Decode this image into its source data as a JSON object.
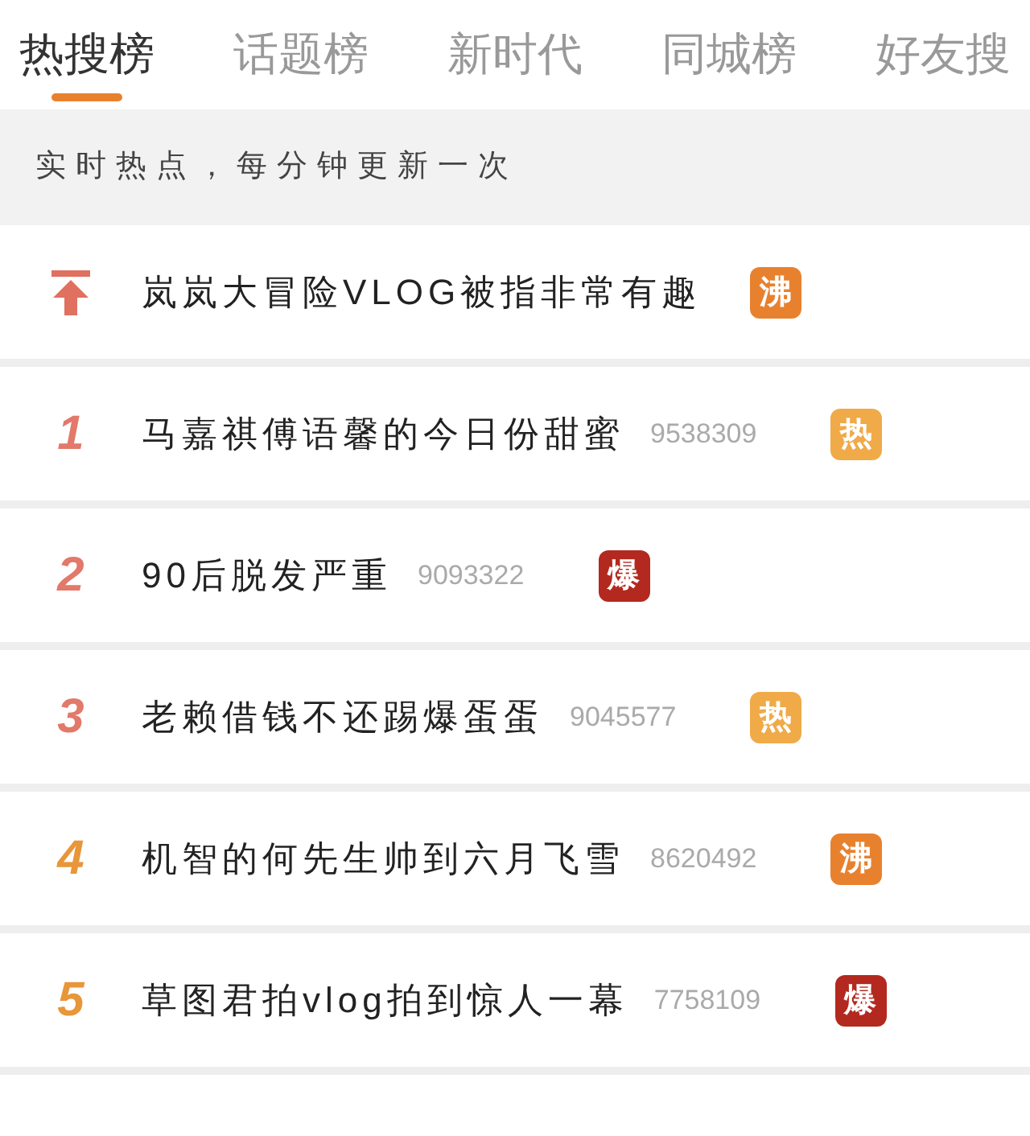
{
  "tabs": [
    {
      "label": "热搜榜",
      "selected": true
    },
    {
      "label": "话题榜",
      "selected": false
    },
    {
      "label": "新时代",
      "selected": false
    },
    {
      "label": "同城榜",
      "selected": false
    },
    {
      "label": "好友搜",
      "selected": false
    }
  ],
  "notice": "实时热点，每分钟更新一次",
  "items": [
    {
      "kind": "pinned",
      "title": "岚岚大冒险VLOG被指非常有趣",
      "badge": {
        "text": "沸",
        "color": "#e8812e"
      }
    },
    {
      "kind": "ranked",
      "rank": "1",
      "color": "#e2796a",
      "title": "马嘉祺傅语馨的今日份甜蜜",
      "count": "9538309",
      "badge": {
        "text": "热",
        "color": "#f0aa48"
      }
    },
    {
      "kind": "ranked",
      "rank": "2",
      "color": "#e2796a",
      "title": "90后脱发严重",
      "count": "9093322",
      "badge": {
        "text": "爆",
        "color": "#b3291f"
      }
    },
    {
      "kind": "ranked",
      "rank": "3",
      "color": "#e2796a",
      "title": "老赖借钱不还踢爆蛋蛋",
      "count": "9045577",
      "badge": {
        "text": "热",
        "color": "#f0aa48"
      }
    },
    {
      "kind": "ranked",
      "rank": "4",
      "color": "#e8963a",
      "title": "机智的何先生帅到六月飞雪",
      "count": "8620492",
      "badge": {
        "text": "沸",
        "color": "#e8812e"
      }
    },
    {
      "kind": "ranked",
      "rank": "5",
      "color": "#e8963a",
      "title": "草图君拍vlog拍到惊人一幕",
      "count": "7758109",
      "badge": {
        "text": "爆",
        "color": "#b3291f"
      }
    }
  ]
}
